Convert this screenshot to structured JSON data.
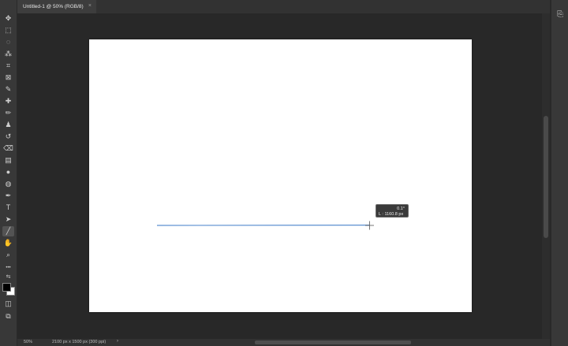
{
  "document_tab": {
    "title": "Untitled-1 @ 50% (RGB/8)",
    "close_glyph": "×"
  },
  "toolbar": {
    "tools": [
      {
        "name": "move-tool-icon",
        "glyph": "✥"
      },
      {
        "name": "marquee-tool-icon",
        "glyph": "⬚"
      },
      {
        "name": "lasso-tool-icon",
        "glyph": "◌"
      },
      {
        "name": "quick-select-tool-icon",
        "glyph": "⁂"
      },
      {
        "name": "crop-tool-icon",
        "glyph": "⌗"
      },
      {
        "name": "frame-tool-icon",
        "glyph": "⊠"
      },
      {
        "name": "eyedropper-tool-icon",
        "glyph": "✎"
      },
      {
        "name": "healing-brush-tool-icon",
        "glyph": "✚"
      },
      {
        "name": "brush-tool-icon",
        "glyph": "✏"
      },
      {
        "name": "clone-stamp-tool-icon",
        "glyph": "♟"
      },
      {
        "name": "history-brush-tool-icon",
        "glyph": "↺"
      },
      {
        "name": "eraser-tool-icon",
        "glyph": "⌫"
      },
      {
        "name": "gradient-tool-icon",
        "glyph": "▤"
      },
      {
        "name": "blur-tool-icon",
        "glyph": "●"
      },
      {
        "name": "dodge-tool-icon",
        "glyph": "◍"
      },
      {
        "name": "pen-tool-icon",
        "glyph": "✒"
      },
      {
        "name": "type-tool-icon",
        "glyph": "T"
      },
      {
        "name": "path-select-tool-icon",
        "glyph": "➤"
      },
      {
        "name": "line-tool-icon",
        "glyph": "╱"
      },
      {
        "name": "hand-tool-icon",
        "glyph": "✋"
      },
      {
        "name": "zoom-tool-icon",
        "glyph": "⌕"
      },
      {
        "name": "edit-toolbar-icon",
        "glyph": "•••"
      }
    ],
    "active_tool": "line-tool-icon",
    "foreground_color": "#000000",
    "background_color": "#ffffff"
  },
  "hud": {
    "angle": "0.1°",
    "length": "L : 1160.8 px"
  },
  "status_bar": {
    "zoom": "50%",
    "doc_info": "2100 px x 1500 px (300 ppi)",
    "arrow": "›"
  },
  "canvas": {
    "background": "#ffffff"
  },
  "line": {
    "color": "#5b8fd0"
  }
}
